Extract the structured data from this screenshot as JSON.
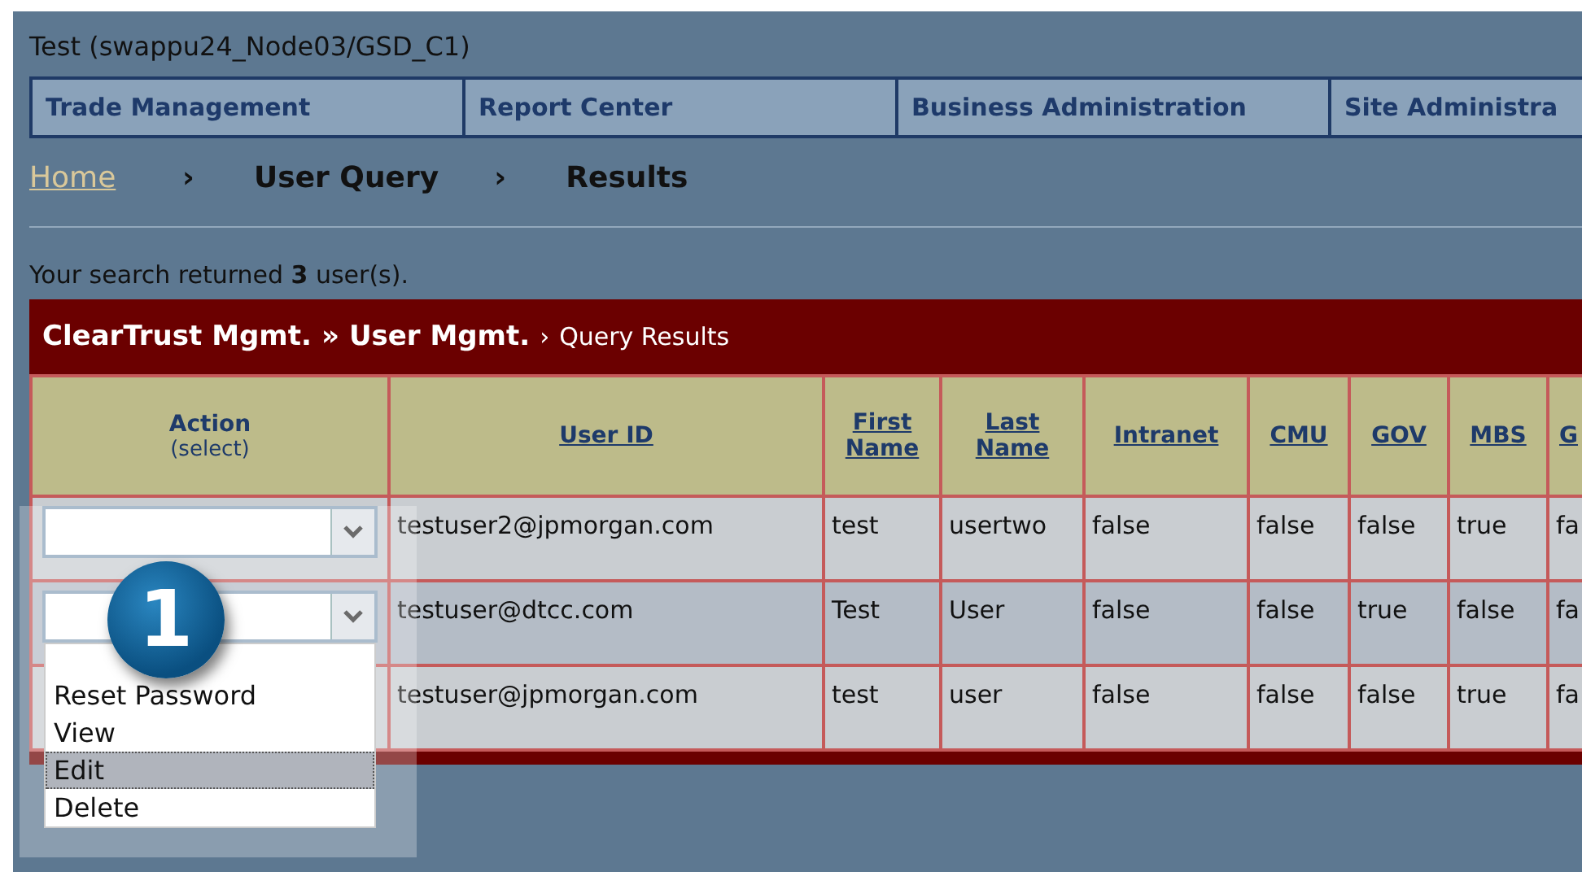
{
  "window": {
    "title": "Test (swappu24_Node03/GSD_C1)"
  },
  "nav_tabs": [
    {
      "label": "Trade Management"
    },
    {
      "label": "Report Center"
    },
    {
      "label": "Business Administration"
    },
    {
      "label": "Site Administra"
    }
  ],
  "breadcrumb": [
    {
      "label": "Home",
      "kind": "link"
    },
    {
      "label": "›",
      "kind": "separator"
    },
    {
      "label": "User Query",
      "kind": "current"
    },
    {
      "label": "›",
      "kind": "separator"
    },
    {
      "label": "Results",
      "kind": "current"
    }
  ],
  "summary": "Your search returned **3** user(s).",
  "panel": {
    "path": [
      {
        "label": "ClearTrust Mgmt.",
        "kind": "strong"
      },
      {
        "label": "»",
        "kind": "strong"
      },
      {
        "label": "User Mgmt.",
        "kind": "strong"
      },
      {
        "label": "›",
        "kind": "plain"
      },
      {
        "label": "Query Results",
        "kind": "plain"
      }
    ]
  },
  "table": {
    "columns": [
      {
        "label": "Action",
        "sub": "(select)",
        "kind": "action"
      },
      {
        "label": "User ID",
        "kind": "sort"
      },
      {
        "label": "First Name",
        "kind": "sort"
      },
      {
        "label": "Last Name",
        "kind": "sort"
      },
      {
        "label": "Intranet",
        "kind": "sort"
      },
      {
        "label": "CMU",
        "kind": "sort"
      },
      {
        "label": "GOV",
        "kind": "sort"
      },
      {
        "label": "MBS",
        "kind": "sort"
      },
      {
        "label": "G",
        "kind": "sort"
      }
    ],
    "rows": [
      {
        "open": false,
        "cells": [
          "",
          "testuser2@jpmorgan.com",
          "test",
          "usertwo",
          "false",
          "false",
          "false",
          "true",
          "fa"
        ]
      },
      {
        "open": true,
        "cells": [
          "",
          "testuser@dtcc.com",
          "Test",
          "User",
          "false",
          "false",
          "true",
          "false",
          "fa"
        ]
      },
      {
        "cells": [
          "",
          "testuser@jpmorgan.com",
          "test",
          "user",
          "false",
          "false",
          "false",
          "true",
          "fa"
        ]
      }
    ]
  },
  "dropdown": {
    "options": [
      {
        "label": "Reset Password",
        "selected": false
      },
      {
        "label": "View",
        "selected": false
      },
      {
        "label": "Edit",
        "selected": true
      },
      {
        "label": "Delete",
        "selected": false
      }
    ]
  },
  "callout": {
    "number": "1"
  }
}
